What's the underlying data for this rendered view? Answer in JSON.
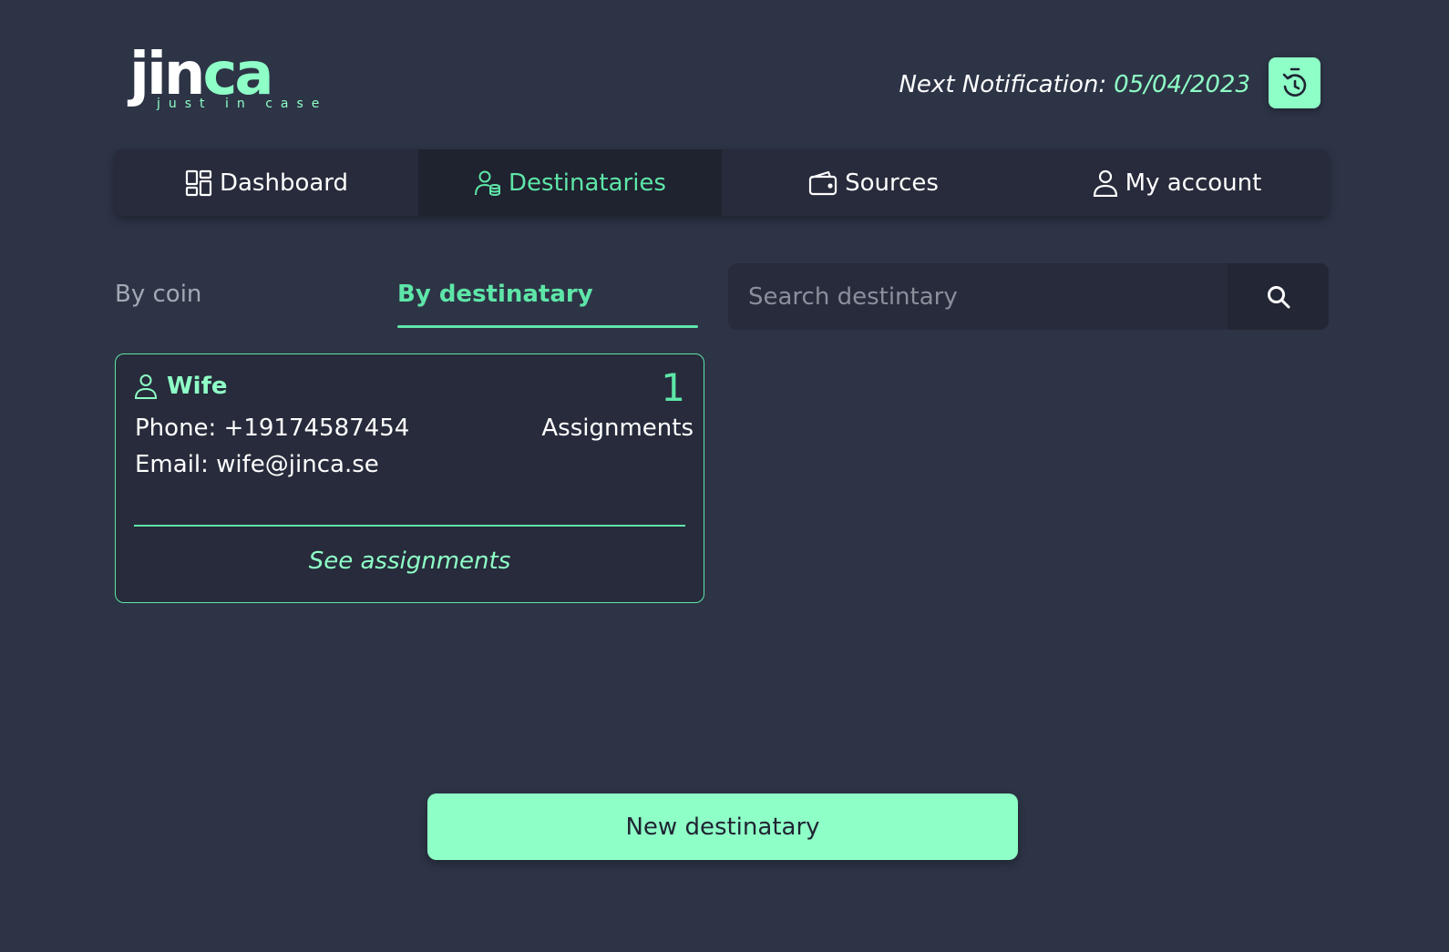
{
  "brand": {
    "logo_main": "jin",
    "logo_accent": "ca",
    "tagline": "just in case"
  },
  "header": {
    "notification_label": "Next Notification:",
    "notification_date": "05/04/2023",
    "timer_icon": "timer-reset-icon"
  },
  "nav": {
    "items": [
      {
        "label": "Dashboard",
        "icon": "dashboard-icon",
        "active": false
      },
      {
        "label": "Destinataries",
        "icon": "user-coins-icon",
        "active": true
      },
      {
        "label": "Sources",
        "icon": "wallet-icon",
        "active": false
      },
      {
        "label": "My account",
        "icon": "user-icon",
        "active": false
      }
    ]
  },
  "tabs": {
    "by_coin": "By coin",
    "by_destinatary": "By destinatary",
    "active": "By destinatary"
  },
  "search": {
    "placeholder": "Search destintary",
    "value": "",
    "icon": "search-icon"
  },
  "destinataries": [
    {
      "name": "Wife",
      "phone": "Phone: +19174587454",
      "email": "Email: wife@jinca.se",
      "assignments_count": "1",
      "assignments_label": "Assignments",
      "link": "See assignments"
    }
  ],
  "actions": {
    "new_destinatary": "New destinatary"
  },
  "colors": {
    "background": "#2d3446",
    "panel": "#272b3b",
    "accent": "#8effc6",
    "accent_dark": "#5ee6a8"
  }
}
